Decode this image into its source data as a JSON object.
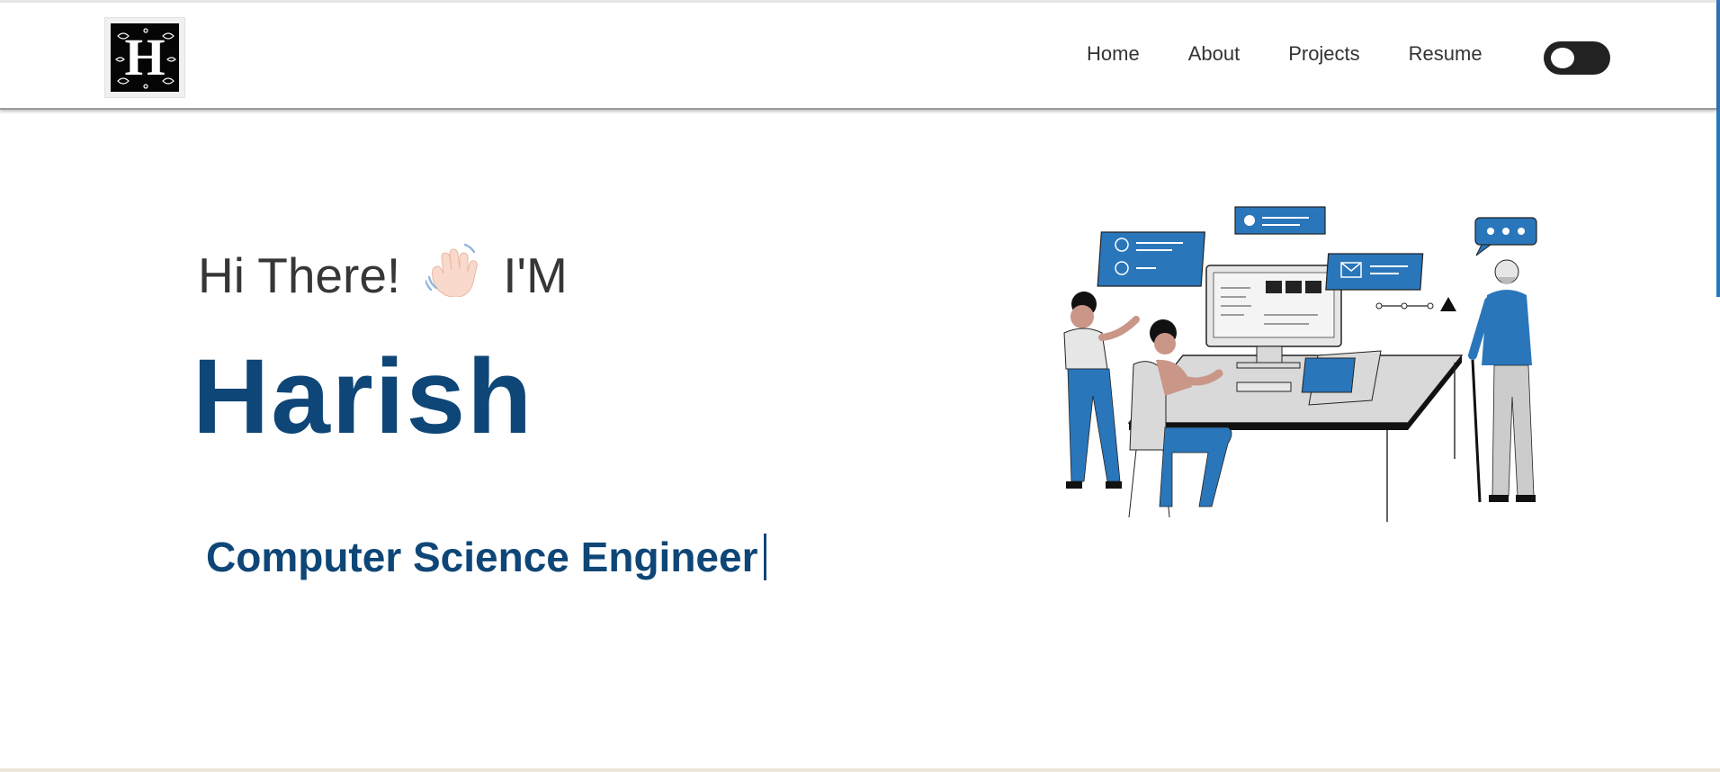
{
  "navbar": {
    "logo_letter": "H",
    "links": [
      {
        "label": "Home"
      },
      {
        "label": "About"
      },
      {
        "label": "Projects"
      },
      {
        "label": "Resume"
      }
    ]
  },
  "hero": {
    "greeting": "Hi There!",
    "wave_emoji": "👋🏻",
    "im": "I'M",
    "name": "Harish",
    "role": "Computer Science Engineer"
  },
  "colors": {
    "accent": "#0e4677",
    "illustration_blue": "#2a76bb",
    "text": "#363636"
  }
}
